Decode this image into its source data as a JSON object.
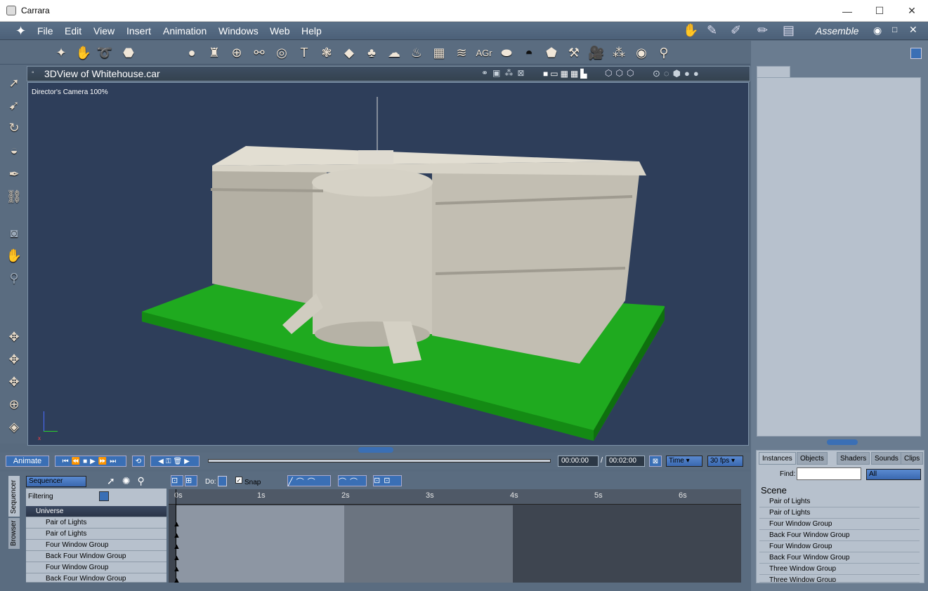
{
  "window": {
    "title": "Carrara",
    "min": "—",
    "max": "☐",
    "close": "✕"
  },
  "menu": [
    "File",
    "Edit",
    "View",
    "Insert",
    "Animation",
    "Windows",
    "Web",
    "Help"
  ],
  "room": "Assemble",
  "viewport": {
    "title": "3DView of Whitehouse.car",
    "camera": "Director's Camera 100%"
  },
  "anim": {
    "animate": "Animate",
    "current": "00:00:00",
    "separator": "/",
    "total": "00:02:00",
    "time": "Time",
    "fps": "30 fps"
  },
  "seq": {
    "mode": "Sequencer",
    "do": "Do:",
    "snap": "Snap",
    "filtering": "Filtering",
    "tracks": [
      "Universe",
      "Pair of Lights",
      "Pair of Lights",
      "Four Window Group",
      "Back Four Window Group",
      "Four Window Group",
      "Back Four Window Group"
    ],
    "ticks": [
      "0s",
      "1s",
      "2s",
      "3s",
      "4s",
      "5s",
      "6s"
    ]
  },
  "sidetabs": [
    "Sequencer",
    "Browser"
  ],
  "browser": {
    "tabs": [
      "Instances",
      "Objects",
      "Shaders",
      "Sounds",
      "Clips"
    ],
    "find": "Find:",
    "all": "All",
    "scene": "Scene",
    "items": [
      "Pair of Lights",
      "Pair of Lights",
      "Four Window Group",
      "Back Four Window Group",
      "Four Window Group",
      "Back Four Window Group",
      "Three Window Group",
      "Three Window Group"
    ]
  }
}
